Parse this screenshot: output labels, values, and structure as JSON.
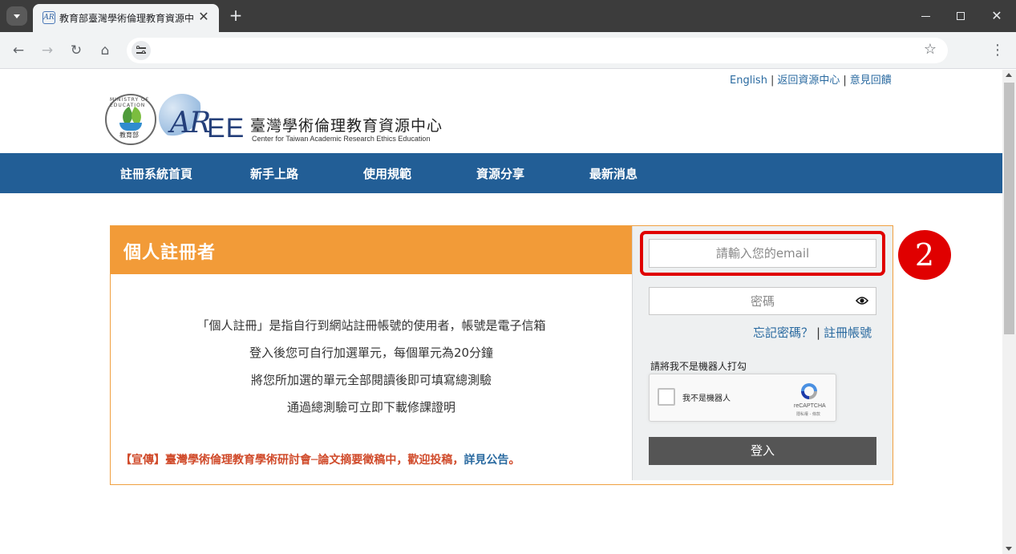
{
  "browser": {
    "tab_title": "教育部臺灣學術倫理教育資源中",
    "tab_favicon_text": "AR",
    "new_tab_icon": "plus-icon",
    "url": ""
  },
  "header": {
    "links": [
      "English",
      "返回資源中心",
      "意見回饋"
    ],
    "logo_title": "臺灣學術倫理教育資源中心",
    "logo_subtitle": "Center for Taiwan Academic Research Ethics Education",
    "moe_text": "教育部",
    "moe_ring_text": "MINISTRY OF EDUCATION"
  },
  "nav": {
    "items": [
      "註冊系統首頁",
      "新手上路",
      "使用規範",
      "資源分享",
      "最新消息"
    ]
  },
  "card": {
    "title": "個人註冊者",
    "intro_lines": [
      "「個人註冊」是指自行到網站註冊帳號的使用者，帳號是電子信箱",
      "登入後您可自行加選單元，每個單元為20分鐘",
      "將您所加選的單元全部閱讀後即可填寫總測驗",
      "通過總測驗可立即下載修課證明"
    ],
    "promo_text": "【宣傳】臺灣學術倫理教育學術研討會─論文摘要徵稿中，歡迎投稿，",
    "promo_link": "詳見公告",
    "promo_end": "。"
  },
  "login": {
    "email_placeholder": "請輸入您的email",
    "password_placeholder": "密碼",
    "forgot_password": "忘記密碼？",
    "register": "註冊帳號",
    "captcha_label": "請將我不是機器人打勾",
    "captcha_text": "我不是機器人",
    "recaptcha_name": "reCAPTCHA",
    "recaptcha_terms": "隱私權 - 條款",
    "login_button": "登入"
  },
  "annotation": {
    "step_number": "2",
    "color": "#e00000"
  }
}
